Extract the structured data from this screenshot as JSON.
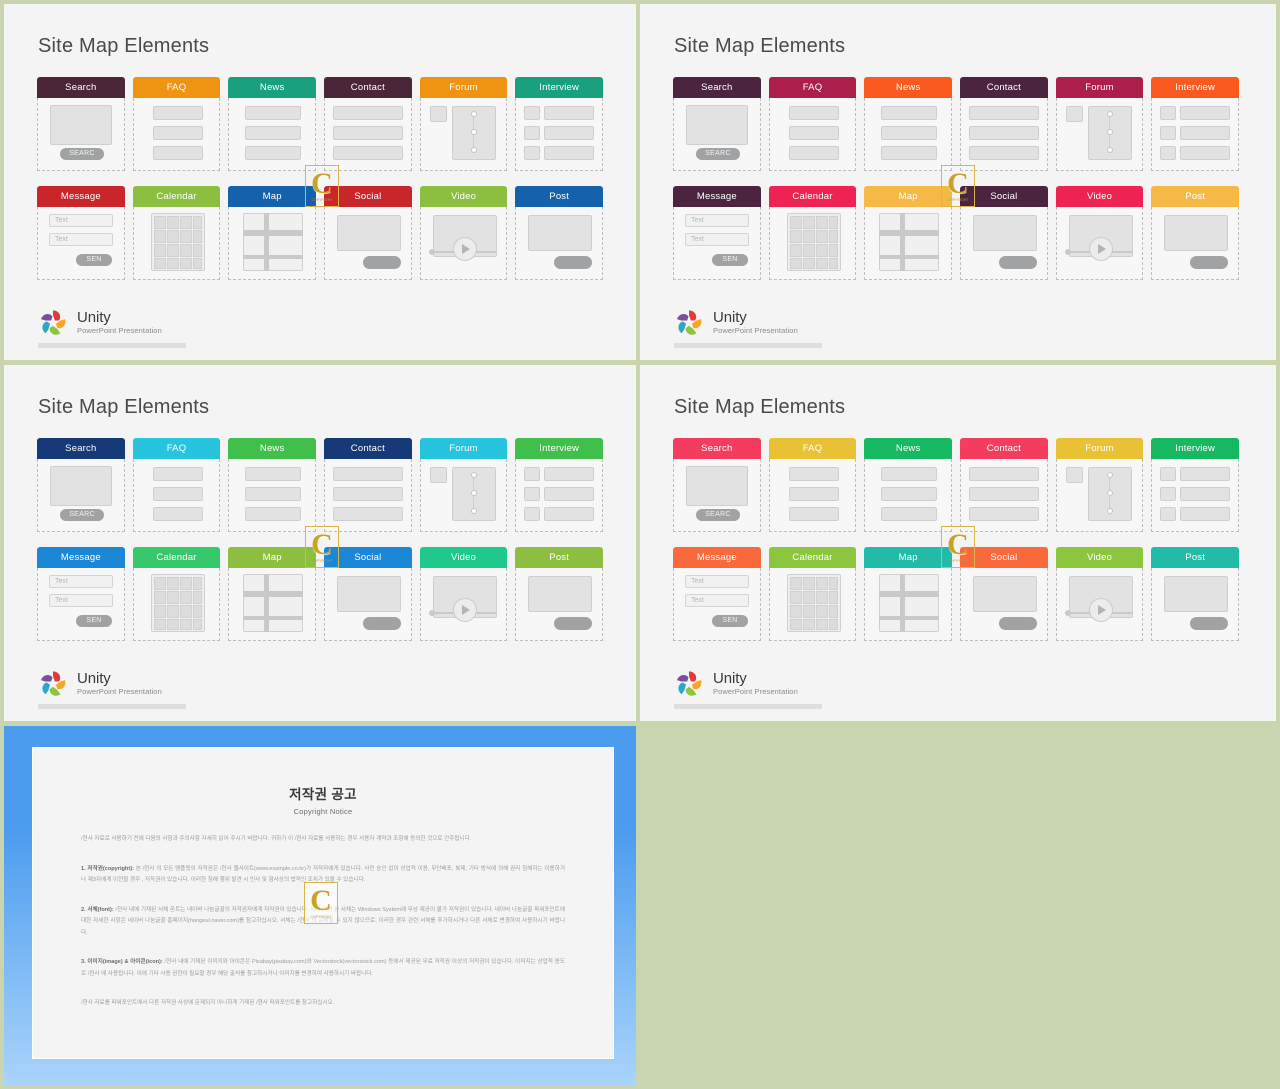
{
  "page": {
    "background_color": "#c8d5af",
    "watermark": {
      "glyph": "C",
      "caption": "COPYRIGHT"
    }
  },
  "slides": [
    {
      "id": "slide-1",
      "title": "Site Map Elements",
      "cards": [
        {
          "label": "Search",
          "color": "#4b2638",
          "type": "search"
        },
        {
          "label": "FAQ",
          "color": "#ef9313",
          "type": "list"
        },
        {
          "label": "News",
          "color": "#19a07f",
          "type": "list"
        },
        {
          "label": "Contact",
          "color": "#4b2638",
          "type": "wide-list"
        },
        {
          "label": "Forum",
          "color": "#ef9313",
          "type": "thread"
        },
        {
          "label": "Interview",
          "color": "#19a07f",
          "type": "media-list"
        },
        {
          "label": "Message",
          "color": "#c8262a",
          "type": "form"
        },
        {
          "label": "Calendar",
          "color": "#8cbf3f",
          "type": "calendar"
        },
        {
          "label": "Map",
          "color": "#1661ab",
          "type": "map"
        },
        {
          "label": "Social",
          "color": "#c8262a",
          "type": "post"
        },
        {
          "label": "Video",
          "color": "#8cbf3f",
          "type": "video"
        },
        {
          "label": "Post",
          "color": "#1661ab",
          "type": "post"
        }
      ],
      "logo": {
        "name": "Unity",
        "tagline": "PowerPoint Presentation"
      }
    },
    {
      "id": "slide-2",
      "title": "Site Map Elements",
      "cards": [
        {
          "label": "Search",
          "color": "#4b2540",
          "type": "search"
        },
        {
          "label": "FAQ",
          "color": "#ad1f4b",
          "type": "list"
        },
        {
          "label": "News",
          "color": "#fa5a1e",
          "type": "list"
        },
        {
          "label": "Contact",
          "color": "#4b2540",
          "type": "wide-list"
        },
        {
          "label": "Forum",
          "color": "#ad1f4b",
          "type": "thread"
        },
        {
          "label": "Interview",
          "color": "#fa5a1e",
          "type": "media-list"
        },
        {
          "label": "Message",
          "color": "#4b2540",
          "type": "form"
        },
        {
          "label": "Calendar",
          "color": "#ee2354",
          "type": "calendar"
        },
        {
          "label": "Map",
          "color": "#f7b945",
          "type": "map"
        },
        {
          "label": "Social",
          "color": "#4b2540",
          "type": "post"
        },
        {
          "label": "Video",
          "color": "#ee2354",
          "type": "video"
        },
        {
          "label": "Post",
          "color": "#f7b945",
          "type": "post"
        }
      ],
      "logo": {
        "name": "Unity",
        "tagline": "PowerPoint Presentation"
      }
    },
    {
      "id": "slide-3",
      "title": "Site Map Elements",
      "cards": [
        {
          "label": "Search",
          "color": "#153a77",
          "type": "search"
        },
        {
          "label": "FAQ",
          "color": "#27c4e0",
          "type": "list"
        },
        {
          "label": "News",
          "color": "#41bf4b",
          "type": "list"
        },
        {
          "label": "Contact",
          "color": "#153a77",
          "type": "wide-list"
        },
        {
          "label": "Forum",
          "color": "#27c4e0",
          "type": "thread"
        },
        {
          "label": "Interview",
          "color": "#41bf4b",
          "type": "media-list"
        },
        {
          "label": "Message",
          "color": "#1c87d6",
          "type": "form"
        },
        {
          "label": "Calendar",
          "color": "#38c86c",
          "type": "calendar"
        },
        {
          "label": "Map",
          "color": "#8cbf3f",
          "type": "map"
        },
        {
          "label": "Social",
          "color": "#1c87d6",
          "type": "post"
        },
        {
          "label": "Video",
          "color": "#1fc98b",
          "type": "video"
        },
        {
          "label": "Post",
          "color": "#8cbf3f",
          "type": "post"
        }
      ],
      "logo": {
        "name": "Unity",
        "tagline": "PowerPoint Presentation"
      }
    },
    {
      "id": "slide-4",
      "title": "Site Map Elements",
      "cards": [
        {
          "label": "Search",
          "color": "#f43d5e",
          "type": "search"
        },
        {
          "label": "FAQ",
          "color": "#e8c234",
          "type": "list"
        },
        {
          "label": "News",
          "color": "#17b862",
          "type": "list"
        },
        {
          "label": "Contact",
          "color": "#f43d5e",
          "type": "wide-list"
        },
        {
          "label": "Forum",
          "color": "#e8c234",
          "type": "thread"
        },
        {
          "label": "Interview",
          "color": "#17b862",
          "type": "media-list"
        },
        {
          "label": "Message",
          "color": "#f9693c",
          "type": "form"
        },
        {
          "label": "Calendar",
          "color": "#8cc63e",
          "type": "calendar"
        },
        {
          "label": "Map",
          "color": "#21bba7",
          "type": "map"
        },
        {
          "label": "Social",
          "color": "#f9693c",
          "type": "post"
        },
        {
          "label": "Video",
          "color": "#8cc63e",
          "type": "video"
        },
        {
          "label": "Post",
          "color": "#21bba7",
          "type": "post"
        }
      ],
      "logo": {
        "name": "Unity",
        "tagline": "PowerPoint Presentation"
      }
    }
  ],
  "widget_labels": {
    "search_button": "SEARC",
    "send_button": "SEN",
    "text_field_1": "Text",
    "text_field_2": "Text"
  },
  "copyright_slide": {
    "title": "저작권 공고",
    "subtitle": "Copyright Notice",
    "paragraphs": [
      "/현사 자료로 사용하기 전에 다음의 사항과 주의사항 자세히 읽어 주시기 바랍니다. 귀하가 이 /현사 자료를 사용하는 경우 사용자 계약과 조항에 동의한 것으로 간주됩니다.",
      "<b>1. 저작권(copyright):</b> 본 /현사 의 모든 템플릿의 저작권은 /현사 웹사이트(www.example.co.kr)가 저작자에게 있습니다. 사전 승인 없이 상업적 이용, 무단배포, 복제, 기타 방식에 의해 권리 침해하는 이용하거나 제3자에게 이전할 경우 , 저작권이 있습니다. 이러한 침해 행위 발견 시 민사 및 형사상의 법적인 조치가 있을 수 있습니다.",
      "<b>2. 서체(font):</b> /현사 내에 기재된 서체 폰트는 네이버 나눔글꼴의 저작권자에게 저작권이 있습니다. 서체 이외 본 서체는 Windows System에 무상 제공이 불가 저작권이 있습니다. 네이버 나눔글꼴 파워포인트에 대한 자세한 사항은 네이버 나눔글꼴 홈페이지(hangeul.naver.com)를 참고하십시오. 서체는 /현사 의 교체될 수 있지 않으므로, 이러한 경우 관련 서체를 추가하시거나 다른 서체로 변경하여 사용하시기 바랍니다.",
      "<b>3. 이미지(image) & 아이콘(icon):</b> /현사 내에 기재된 이미지와 아이콘은 Pixabay(pixabay.com)와 Vectorstock(vectorstock.com) 등에서 제공된 무료 저작권 이상의 저작권이 있습니다. 이미지는 상업적 용도로 /현사 에 사용됩니다. 이에 기타 사용 권한이 필요할 경우 해당 출처를 참고하시거나 이미지를 변경하여 사용하시기 바랍니다.",
      "/현사 자료를 파워포인트에서 다른 저작권 사상에 문제되지 아니하게 기재된 /현사 파워포인트를 참고하십시오."
    ]
  }
}
